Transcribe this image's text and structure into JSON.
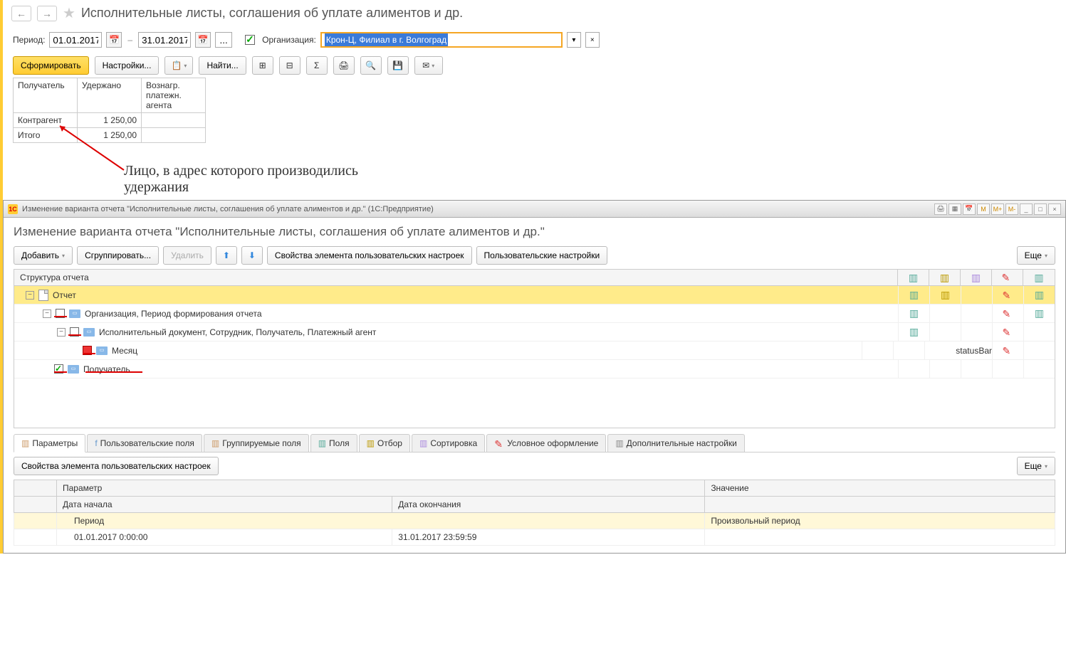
{
  "header": {
    "title": "Исполнительные листы, соглашения об уплате алиментов и др."
  },
  "filter": {
    "period_label": "Период:",
    "date_from": "01.01.2017",
    "date_to": "31.01.2017",
    "org_label": "Организация:",
    "org_value": "Крон-Ц, Филиал в г. Волгоград"
  },
  "toolbar": {
    "form": "Сформировать",
    "settings": "Настройки...",
    "find": "Найти..."
  },
  "report": {
    "cols": {
      "recipient": "Получатель",
      "withheld": "Удержано",
      "agent_fee": "Вознагр. платежн. агента"
    },
    "rows": [
      {
        "label": "Контрагент",
        "withheld": "1 250,00",
        "fee": ""
      },
      {
        "label": "Итого",
        "withheld": "1 250,00",
        "fee": ""
      }
    ]
  },
  "annotation": {
    "text1": "Лицо, в адрес которого производились",
    "text2": "удержания"
  },
  "subwindow": {
    "titlebar": "Изменение варианта отчета \"Исполнительные листы, соглашения об уплате алиментов и др.\"  (1С:Предприятие)",
    "win_buttons": [
      "M",
      "M+",
      "M-"
    ],
    "heading": "Изменение варианта отчета \"Исполнительные листы, соглашения об уплате алиментов и др.\"",
    "toolbar": {
      "add": "Добавить",
      "group": "Сгруппировать...",
      "delete": "Удалить",
      "props": "Свойства элемента пользовательских настроек",
      "user_settings": "Пользовательские настройки",
      "more": "Еще"
    },
    "tree": {
      "header": "Структура отчета",
      "nodes": {
        "report": "Отчет",
        "org": "Организация, Период формирования отчета",
        "doc": "Исполнительный документ, Сотрудник, Получатель, Платежный агент",
        "month": "Месяц",
        "recipient": "Получатель"
      }
    },
    "tabs": {
      "params": "Параметры",
      "user_fields": "Пользовательские поля",
      "group_fields": "Группируемые поля",
      "fields": "Поля",
      "filter": "Отбор",
      "sort": "Сортировка",
      "cond_format": "Условное оформление",
      "extra": "Дополнительные настройки"
    },
    "params_toolbar": {
      "props": "Свойства элемента пользовательских настроек",
      "more": "Еще"
    },
    "params_table": {
      "cols": {
        "param": "Параметр",
        "value": "Значение",
        "begin": "Дата начала",
        "end": "Дата окончания"
      },
      "rows": [
        {
          "param": "Период",
          "value": "Произвольный период",
          "alt": true
        },
        {
          "param": "01.01.2017 0:00:00",
          "mid": "31.01.2017 23:59:59",
          "value": ""
        }
      ]
    }
  }
}
